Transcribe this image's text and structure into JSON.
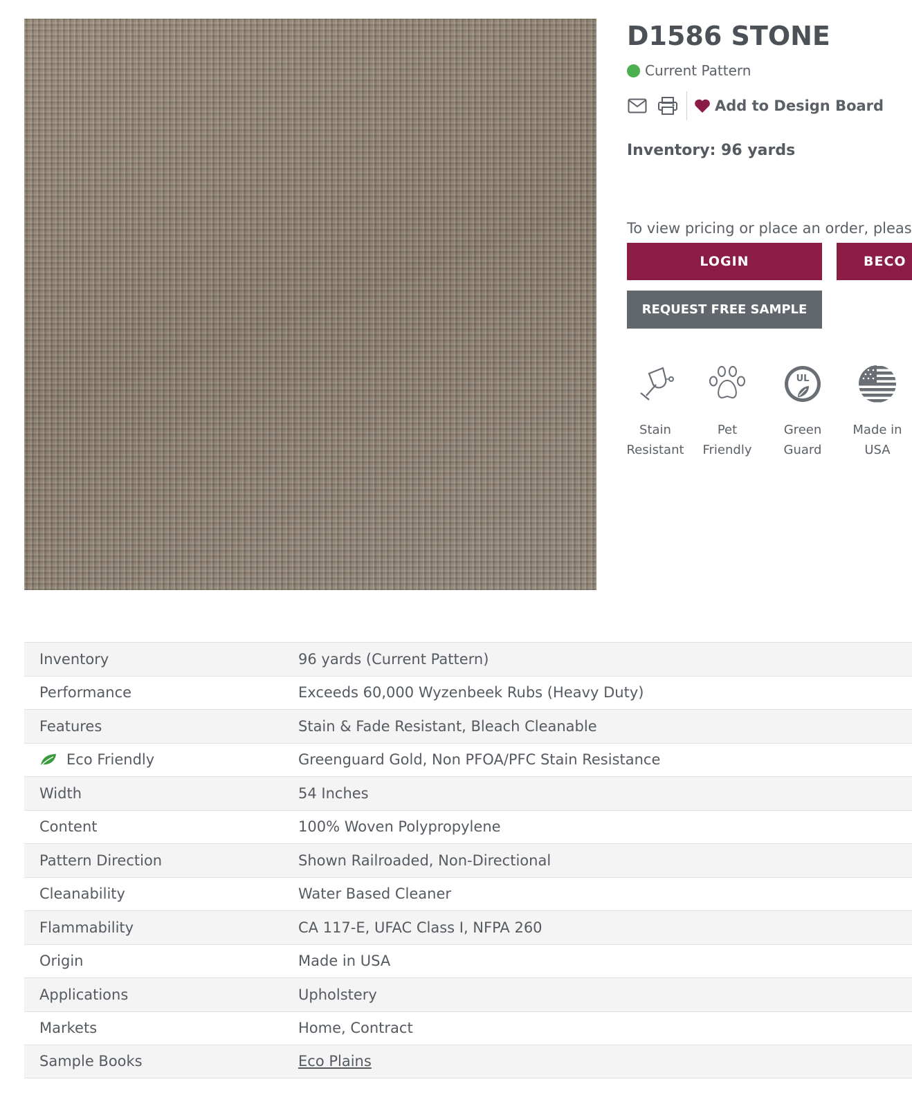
{
  "product": {
    "title": "D1586 STONE",
    "status": "Current Pattern",
    "status_color": "#4caf50",
    "inventory_text": "Inventory: 96 yards",
    "swatch_icon": "fabric-swatch-image"
  },
  "actions": {
    "email_icon": "envelope-icon",
    "print_icon": "printer-icon",
    "design_board_label": "Add to Design Board",
    "design_board_icon": "heart-icon"
  },
  "ordering": {
    "note": "To view pricing or place an order, please",
    "login_label": "LOGIN",
    "become_label": "BECO",
    "sample_label": "REQUEST FREE SAMPLE"
  },
  "features": [
    {
      "line1": "Stain",
      "line2": "Resistant",
      "icon": "wine-glass-stain-icon"
    },
    {
      "line1": "Pet",
      "line2": "Friendly",
      "icon": "paw-print-icon"
    },
    {
      "line1": "Green",
      "line2": "Guard",
      "icon": "ul-greenguard-icon"
    },
    {
      "line1": "Made in",
      "line2": "USA",
      "icon": "us-flag-icon"
    }
  ],
  "specs": [
    {
      "label": "Inventory",
      "value": "96 yards (Current Pattern)"
    },
    {
      "label": "Performance",
      "value": "Exceeds 60,000 Wyzenbeek Rubs (Heavy Duty)"
    },
    {
      "label": "Features",
      "value": "Stain & Fade Resistant, Bleach Cleanable"
    },
    {
      "label": "Eco Friendly",
      "value": "Greenguard Gold, Non PFOA/PFC Stain Resistance",
      "icon": "leaf-icon"
    },
    {
      "label": "Width",
      "value": "54 Inches"
    },
    {
      "label": "Content",
      "value": "100% Woven Polypropylene"
    },
    {
      "label": "Pattern Direction",
      "value": "Shown Railroaded, Non-Directional"
    },
    {
      "label": "Cleanability",
      "value": "Water Based Cleaner"
    },
    {
      "label": "Flammability",
      "value": "CA 117-E, UFAC Class I, NFPA 260"
    },
    {
      "label": "Origin",
      "value": "Made in USA"
    },
    {
      "label": "Applications",
      "value": "Upholstery"
    },
    {
      "label": "Markets",
      "value": "Home, Contract"
    },
    {
      "label": "Sample Books",
      "value": "Eco Plains",
      "link": true
    }
  ],
  "colors": {
    "accent": "#8b1c45",
    "secondary_button": "#62676d",
    "text": "#555a60",
    "eco_green": "#3a9a3e"
  }
}
